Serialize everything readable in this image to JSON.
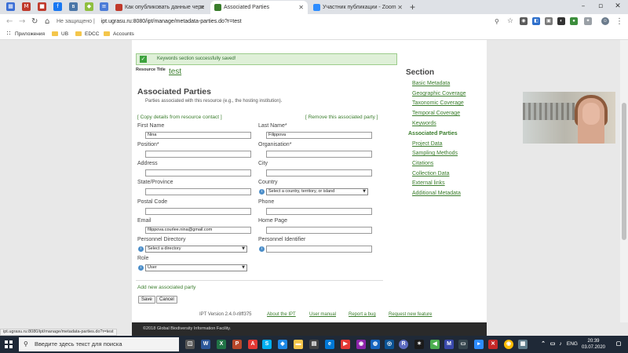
{
  "browser": {
    "tabs": [
      {
        "label": "Как опубликовать данные чере",
        "favicon_color": "#c0392b",
        "active": false
      },
      {
        "label": "Associated Parties",
        "favicon_color": "#3a7d2c",
        "active": true
      },
      {
        "label": "Участник публикации - Zoom",
        "favicon_color": "#2d8cff",
        "active": false
      }
    ],
    "security_label": "Не защищено",
    "url": "ipt.ugrasu.ru:8080/ipt/manage/metadata-parties.do?r=test",
    "bookmarks": [
      {
        "label": "Приложения",
        "kind": "apps"
      },
      {
        "label": "UB",
        "kind": "folder"
      },
      {
        "label": "EDCC",
        "kind": "folder"
      },
      {
        "label": "Accounts",
        "kind": "folder"
      }
    ]
  },
  "page": {
    "notice": "Keywords section successfully saved!",
    "resource_title_label": "Resource Title",
    "resource_title_value": "test",
    "heading": "Associated Parties",
    "intro": "Parties associated with this resource (e.g., the hosting institution).",
    "copy_link": "[ Copy details from resource contact ]",
    "remove_link": "[ Remove this associated party ]",
    "fields": {
      "first_name": {
        "label": "First Name",
        "value": "Nina"
      },
      "last_name": {
        "label": "Last Name*",
        "value": "Filippova"
      },
      "position": {
        "label": "Position*",
        "value": ""
      },
      "organisation": {
        "label": "Organisation*",
        "value": ""
      },
      "address": {
        "label": "Address",
        "value": ""
      },
      "city": {
        "label": "City",
        "value": ""
      },
      "state": {
        "label": "State/Province",
        "value": ""
      },
      "country": {
        "label": "Country",
        "value": "Select a country, territory, or island"
      },
      "postal_code": {
        "label": "Postal Code",
        "value": ""
      },
      "phone": {
        "label": "Phone",
        "value": ""
      },
      "email": {
        "label": "Email",
        "value": "filippova.courlee.nina@gmail.com"
      },
      "home_page": {
        "label": "Home Page",
        "value": ""
      },
      "personnel_directory": {
        "label": "Personnel Directory",
        "value": "Select a directory"
      },
      "personnel_identifier": {
        "label": "Personnel Identifier",
        "value": ""
      },
      "role": {
        "label": "Role",
        "value": "User"
      }
    },
    "add_new_link": "Add new associated party",
    "save_button": "Save",
    "cancel_button": "Cancel",
    "footer": {
      "version": "IPT Version 2.4.0-r8ff375",
      "links": [
        "About the IPT",
        "User manual",
        "Report a bug",
        "Request new feature"
      ],
      "copyright": "©2018 Global Biodiversity Information Facility."
    },
    "section_nav": {
      "title": "Section",
      "items": [
        {
          "label": "Basic Metadata",
          "active": false
        },
        {
          "label": "Geographic Coverage",
          "active": false
        },
        {
          "label": "Taxonomic Coverage",
          "active": false
        },
        {
          "label": "Temporal Coverage",
          "active": false
        },
        {
          "label": "Keywords",
          "active": false
        },
        {
          "label": "Associated Parties",
          "active": true
        },
        {
          "label": "Project Data",
          "active": false
        },
        {
          "label": "Sampling Methods",
          "active": false
        },
        {
          "label": "Citations",
          "active": false
        },
        {
          "label": "Collection Data",
          "active": false
        },
        {
          "label": "External links",
          "active": false
        },
        {
          "label": "Additional Metadata",
          "active": false
        }
      ]
    },
    "status_url": "ipt.ugrasu.ru:8080/ipt/manage/metadata-parties.do?r=test"
  },
  "taskbar": {
    "search_placeholder": "Введите здесь текст для поиска",
    "language": "ENG",
    "time": "20:39",
    "date": "03.07.2020"
  }
}
